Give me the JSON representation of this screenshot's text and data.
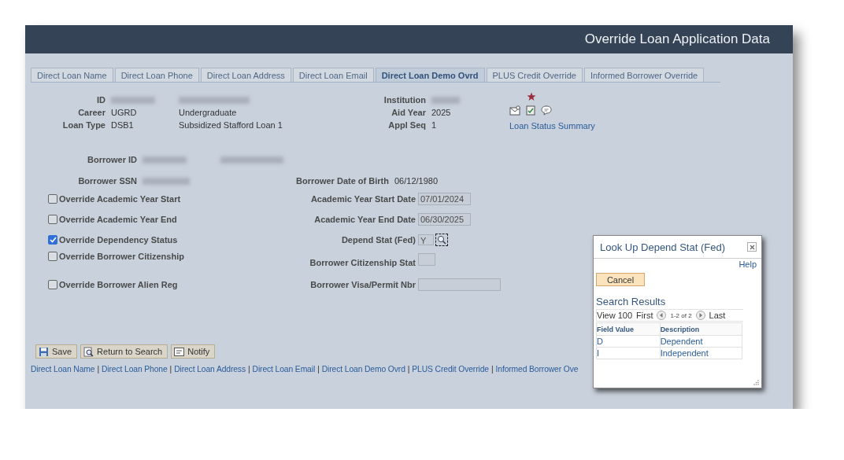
{
  "header": {
    "title": "Override Loan Application Data"
  },
  "tabs": [
    {
      "label": "Direct Loan Name",
      "selected": false
    },
    {
      "label": "Direct Loan Phone",
      "selected": false
    },
    {
      "label": "Direct Loan Address",
      "selected": false
    },
    {
      "label": "Direct Loan Email",
      "selected": false
    },
    {
      "label": "Direct Loan Demo Ovrd",
      "selected": true
    },
    {
      "label": "PLUS Credit Override",
      "selected": false
    },
    {
      "label": "Informed Borrower Override",
      "selected": false
    }
  ],
  "summary": {
    "left": [
      {
        "label": "ID",
        "value_redacted": true,
        "description_redacted": true
      },
      {
        "label": "Career",
        "value": "UGRD",
        "description": "Undergraduate"
      },
      {
        "label": "Loan Type",
        "value": "DSB1",
        "description": "Subsidized Stafford Loan 1"
      }
    ],
    "right": [
      {
        "label": "Institution",
        "value_redacted": true
      },
      {
        "label": "Aid Year",
        "value": "2025"
      },
      {
        "label": "Appl Seq",
        "value": "1"
      }
    ],
    "related_link": "Loan Status Summary"
  },
  "borrower": {
    "id": {
      "label": "Borrower ID",
      "value_redacted": true,
      "name_redacted": true
    },
    "ssn": {
      "label": "Borrower SSN",
      "value_redacted": true
    },
    "birth": {
      "label": "Borrower Date of Birth",
      "value": "06/12/1980"
    }
  },
  "overrides": [
    {
      "label": "Override Academic Year Start",
      "checked": false,
      "field_label": "Academic Year Start Date",
      "kind": "date",
      "value": "07/01/2024"
    },
    {
      "label": "Override Academic Year End",
      "checked": false,
      "field_label": "Academic Year End Date",
      "kind": "date",
      "value": "06/30/2025"
    },
    {
      "label": "Override Dependency Status",
      "checked": true,
      "field_label": "Depend Stat (Fed)",
      "kind": "lookup",
      "value": "Y"
    },
    {
      "label": "Override Borrower Citizenship",
      "checked": false,
      "field_label": "Borrower Citizenship Stat",
      "kind": "short"
    },
    {
      "label": "Override Borrower Alien Reg",
      "checked": false,
      "field_label": "Borrower Visa/Permit Nbr",
      "kind": "wide"
    }
  ],
  "buttons": [
    {
      "label": "Save",
      "kind": "save"
    },
    {
      "label": "Return to Search",
      "kind": "search"
    },
    {
      "label": "Notify",
      "kind": "notify"
    }
  ],
  "footer_separator": "|",
  "footer_links": [
    "Direct Loan Name",
    "Direct Loan Phone",
    "Direct Loan Address",
    "Direct Loan Email",
    "Direct Loan Demo Ovrd",
    "PLUS Credit Override",
    "Informed Borrower Ove"
  ],
  "lookup_dialog": {
    "title": "Look Up Depend Stat (Fed)",
    "help": "Help",
    "cancel": "Cancel",
    "results_title": "Search Results",
    "nav": {
      "view": "View 100",
      "first": "First",
      "range": "1-2 of 2",
      "last": "Last"
    },
    "columns": [
      "Field Value",
      "Description"
    ],
    "rows": [
      [
        "D",
        "Dependent"
      ],
      [
        "I",
        "Independent"
      ]
    ]
  }
}
